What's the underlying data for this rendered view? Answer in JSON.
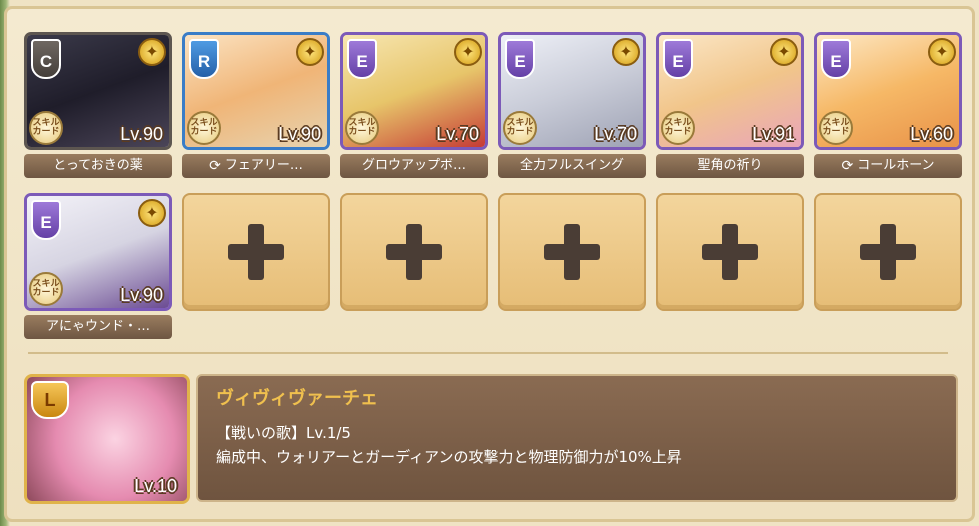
{
  "party": {
    "row1": [
      {
        "rank": "C",
        "level": "Lv.90",
        "skill": "とっておきの薬",
        "skill_cycle": false
      },
      {
        "rank": "R",
        "level": "Lv.90",
        "skill": "フェアリー…",
        "skill_cycle": true
      },
      {
        "rank": "E",
        "level": "Lv.70",
        "skill": "グロウアップボ…",
        "skill_cycle": false
      },
      {
        "rank": "E",
        "level": "Lv.70",
        "skill": "全力フルスイング",
        "skill_cycle": false
      },
      {
        "rank": "E",
        "level": "Lv.91",
        "skill": "聖角の祈り",
        "skill_cycle": false
      },
      {
        "rank": "E",
        "level": "Lv.60",
        "skill": "コールホーン",
        "skill_cycle": true
      }
    ],
    "row2": [
      {
        "rank": "E",
        "level": "Lv.90",
        "skill": "アにゃウンド・…",
        "skill_cycle": false
      }
    ],
    "skill_card_label": "スキルカード",
    "gold_icon": "gold-medal-icon"
  },
  "leader": {
    "rank": "L",
    "level": "Lv.10",
    "name": "ヴィヴィヴァーチェ",
    "skill_title": "【戦いの歌】Lv.1/5",
    "skill_desc": "編成中、ウォリアーとガーディアンの攻撃力と物理防御力が10%上昇"
  },
  "colors": {
    "rank_c": "#5d5650",
    "rank_r": "#3a7dc7",
    "rank_e": "#7c5ab8",
    "leader_gold": "#e0b34a",
    "name_gold": "#f0c04e"
  }
}
